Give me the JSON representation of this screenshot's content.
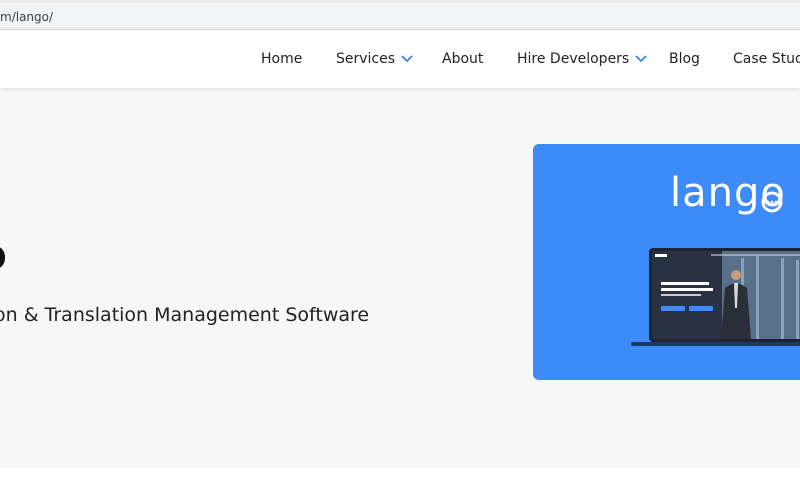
{
  "browser": {
    "url": "m/lango/"
  },
  "nav": {
    "items": [
      {
        "label": "Home"
      },
      {
        "label": "Services",
        "dropdown": true
      },
      {
        "label": "About"
      },
      {
        "label": "Hire Developers",
        "dropdown": true
      },
      {
        "label": "Blog"
      },
      {
        "label": "Case Studi"
      }
    ],
    "chevron_color": "#2a7de1"
  },
  "hero": {
    "title": "o",
    "subtitle": "on & Translation Management Software"
  },
  "card": {
    "background": "#3d8bf8",
    "logo_text": "lango",
    "logo_icon": "chat-bubble-icon",
    "screen_heading": "Run all of your language needs in one, secure platform"
  }
}
